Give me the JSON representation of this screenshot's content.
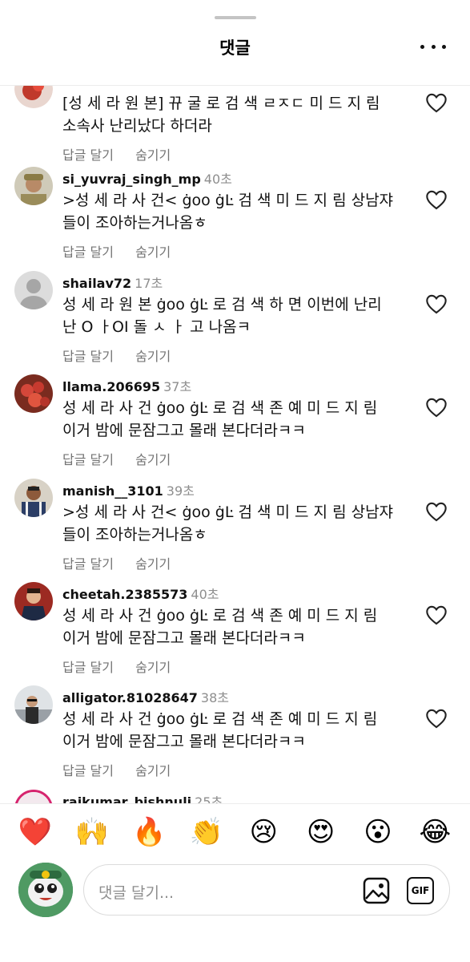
{
  "header": {
    "title": "댓글"
  },
  "comments": [
    {
      "username": "",
      "time": "",
      "line1": "[성 세 라 원 본] 뀨 굴 로 검 색 ㄹㅈㄷ 미 드 지 림",
      "line2": "소속사 난리났다 하더라",
      "reply": "답글 달기",
      "hide": "숨기기",
      "avatar_icon": "flower-avatar-icon"
    },
    {
      "username": "si_yuvraj_singh_mp",
      "time": "40초",
      "line1": ">성 세 라 사 건< ġoo ġĿ  검 색 미 드 지 림 상남쟈",
      "line2": "들이 조아하는거나옴ㅎ",
      "reply": "답글 달기",
      "hide": "숨기기",
      "avatar_icon": "officer-avatar-icon"
    },
    {
      "username": "shailav72",
      "time": "17초",
      "line1": "성 세 라 원 본  ġoo ġĿ 로 검 색 하 면 이번에 난리",
      "line2": "난 O ㅏOI 돌 ㅅ ㅏ 고 나옴ㅋ",
      "reply": "답글 달기",
      "hide": "숨기기",
      "avatar_icon": "default-avatar-icon"
    },
    {
      "username": "llama.206695",
      "time": "37초",
      "line1": "성 세 라 사 건  ġoo ġĿ 로 검 색 존 예 미 드 지 림",
      "line2": "이거 밤에 문잠그고 몰래 본다더라ㅋㅋ",
      "reply": "답글 달기",
      "hide": "숨기기",
      "avatar_icon": "berries-avatar-icon"
    },
    {
      "username": "manish__3101",
      "time": "39초",
      "line1": ">성 세 라 사 건< ġoo ġĿ  검 색 미 드 지 림 상남쟈",
      "line2": "들이 조아하는거나옴ㅎ",
      "reply": "답글 달기",
      "hide": "숨기기",
      "avatar_icon": "man-avatar-icon"
    },
    {
      "username": "cheetah.2385573",
      "time": "40초",
      "line1": "성 세 라 사 건  ġoo ġĿ 로 검 색 존 예 미 드 지 림",
      "line2": "이거 밤에 문잠그고 몰래 본다더라ㅋㅋ",
      "reply": "답글 달기",
      "hide": "숨기기",
      "avatar_icon": "suit-avatar-icon"
    },
    {
      "username": "alligator.81028647",
      "time": "38초",
      "line1": "성 세 라 사 건  ġoo ġĿ 로 검 색 존 예 미 드 지 림",
      "line2": "이거 밤에 문잠그고 몰래 본다더라ㅋㅋ",
      "reply": "답글 달기",
      "hide": "숨기기",
      "avatar_icon": "street-avatar-icon"
    },
    {
      "username": "raikumar_bishnuli",
      "time": "25초",
      "line1": "",
      "line2": "",
      "reply": "",
      "hide": "",
      "avatar_icon": "story-avatar-icon"
    }
  ],
  "emoji_bar": [
    "❤️",
    "🙌",
    "🔥",
    "👏",
    "😢",
    "😍",
    "😮",
    "😂"
  ],
  "input": {
    "placeholder": "댓글 달기...",
    "gif_label": "GIF"
  },
  "colors": {
    "muted": "#8e8e8e",
    "border": "#dbdbdb",
    "text": "#111111"
  }
}
